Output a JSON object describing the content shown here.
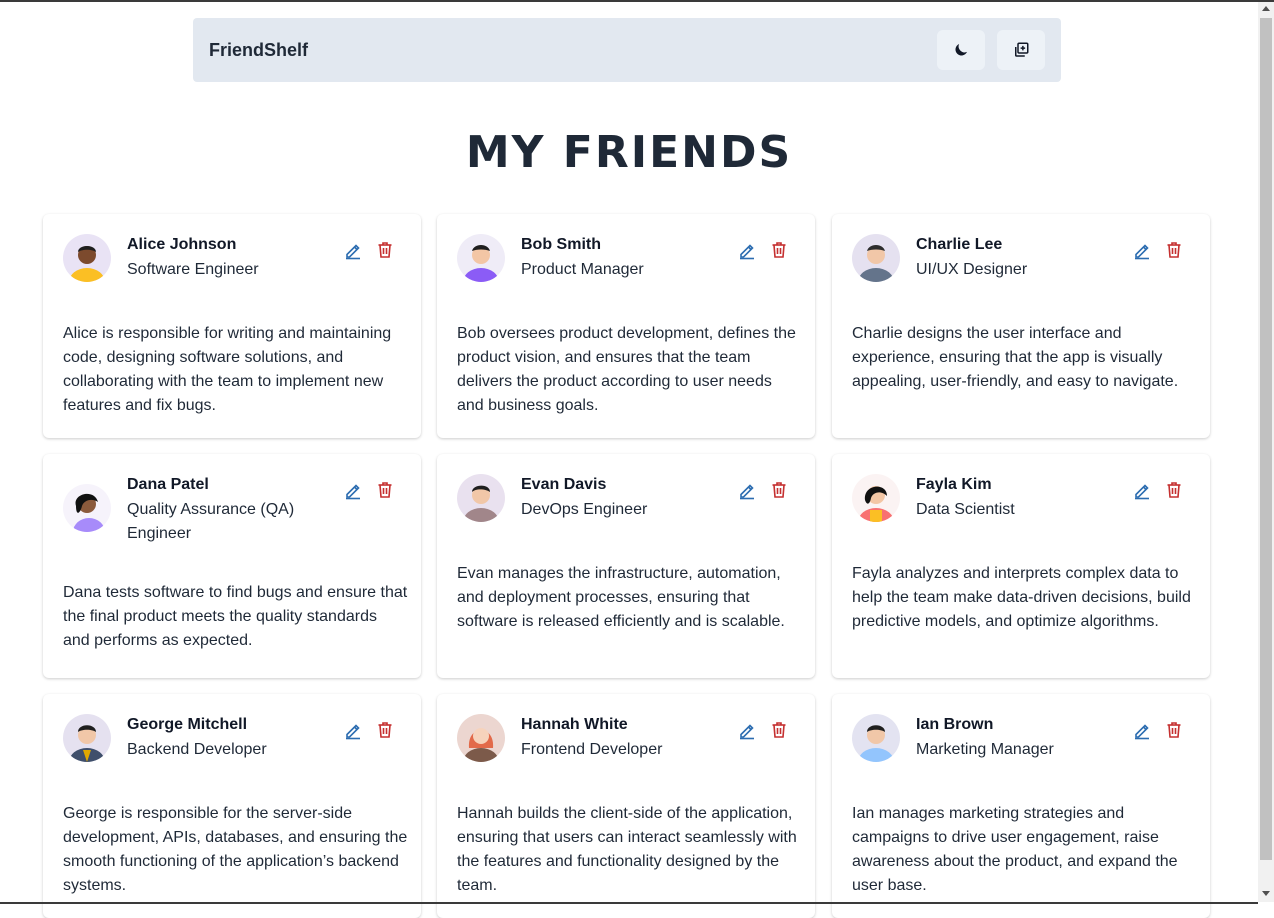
{
  "header": {
    "brand": "FriendShelf",
    "icons": [
      "moon-icon",
      "add-square-icon"
    ]
  },
  "page_title": "MY FRIENDS",
  "colors": {
    "edit": "#2b6cb0",
    "delete": "#c53030",
    "nav_bg": "#e2e8f0"
  },
  "friends": [
    {
      "name": "Alice Johnson",
      "role": "Software Engineer",
      "description": "Alice is responsible for writing and maintaining code, designing software solutions, and collaborating with the team to implement new features and fix bugs."
    },
    {
      "name": "Bob Smith",
      "role": "Product Manager",
      "description": "Bob oversees product development, defines the product vision, and ensures that the team delivers the product according to user needs and business goals."
    },
    {
      "name": "Charlie Lee",
      "role": "UI/UX Designer",
      "description": "Charlie designs the user interface and experience, ensuring that the app is visually appealing, user-friendly, and easy to navigate."
    },
    {
      "name": "Dana Patel",
      "role": "Quality Assurance (QA) Engineer",
      "description": "Dana tests software to find bugs and ensure that the final product meets the quality standards and performs as expected."
    },
    {
      "name": "Evan Davis",
      "role": "DevOps Engineer",
      "description": "Evan manages the infrastructure, automation, and deployment processes, ensuring that software is released efficiently and is scalable."
    },
    {
      "name": "Fayla Kim",
      "role": "Data Scientist",
      "description": "Fayla analyzes and interprets complex data to help the team make data-driven decisions, build predictive models, and optimize algorithms."
    },
    {
      "name": "George Mitchell",
      "role": "Backend Developer",
      "description": "George is responsible for the server-side development, APIs, databases, and ensuring the smooth functioning of the application’s backend systems."
    },
    {
      "name": "Hannah White",
      "role": "Frontend Developer",
      "description": "Hannah builds the client-side of the application, ensuring that users can interact seamlessly with the features and functionality designed by the team."
    },
    {
      "name": "Ian Brown",
      "role": "Marketing Manager",
      "description": "Ian manages marketing strategies and campaigns to drive user engagement, raise awareness about the product, and expand the user base."
    }
  ]
}
